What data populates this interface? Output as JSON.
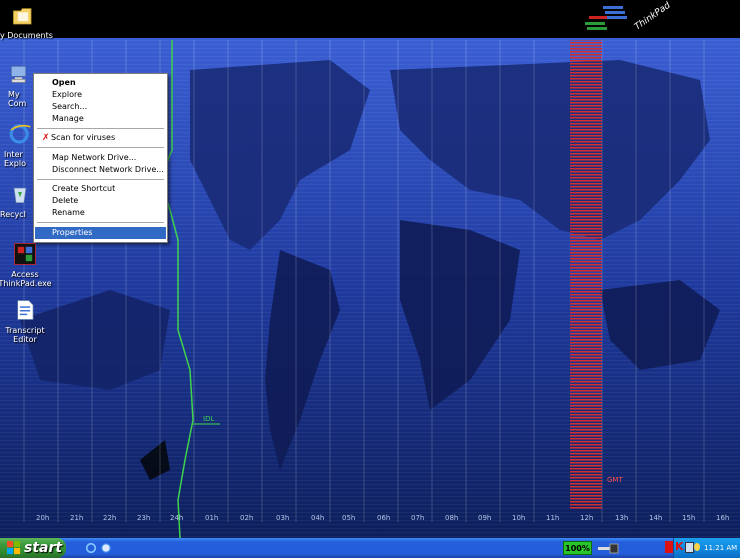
{
  "desktop_icons": [
    {
      "label": "My Documents",
      "icon": "folder-icon"
    },
    {
      "label": "My Com",
      "icon": "computer-icon"
    },
    {
      "label": "Inter Explo",
      "icon": "internet-explorer-icon"
    },
    {
      "label": "Recycl",
      "icon": "recycle-bin-icon"
    },
    {
      "label": "Access ThinkPad.exe",
      "icon": "thinkpad-icon"
    },
    {
      "label": "Transcript Editor",
      "icon": "document-icon"
    }
  ],
  "context_menu": {
    "items": [
      "Open",
      "Explore",
      "Search...",
      "Manage",
      "Scan for viruses",
      "Map Network Drive...",
      "Disconnect Network Drive...",
      "Create Shortcut",
      "Delete",
      "Rename",
      "Properties"
    ],
    "default_item": "Open",
    "selected_item": "Properties"
  },
  "wallpaper": {
    "logo": "ThinkPad",
    "time_zones": [
      "20h",
      "21h",
      "22h",
      "23h",
      "24h",
      "01h",
      "02h",
      "03h",
      "04h",
      "05h",
      "06h",
      "07h",
      "08h",
      "09h",
      "10h",
      "11h",
      "12h",
      "13h",
      "14h",
      "15h",
      "16h"
    ],
    "idl_label": "IDL",
    "gmt_label": "GMT"
  },
  "taskbar": {
    "start_label": "start",
    "battery": "100%",
    "clock": "11:21 AM"
  },
  "colors": {
    "taskbar": "#245edb",
    "start": "#3c9a3c",
    "selection": "#316ac5",
    "idl_line": "#3fd24f",
    "gmt_band": "#c21b1b"
  }
}
